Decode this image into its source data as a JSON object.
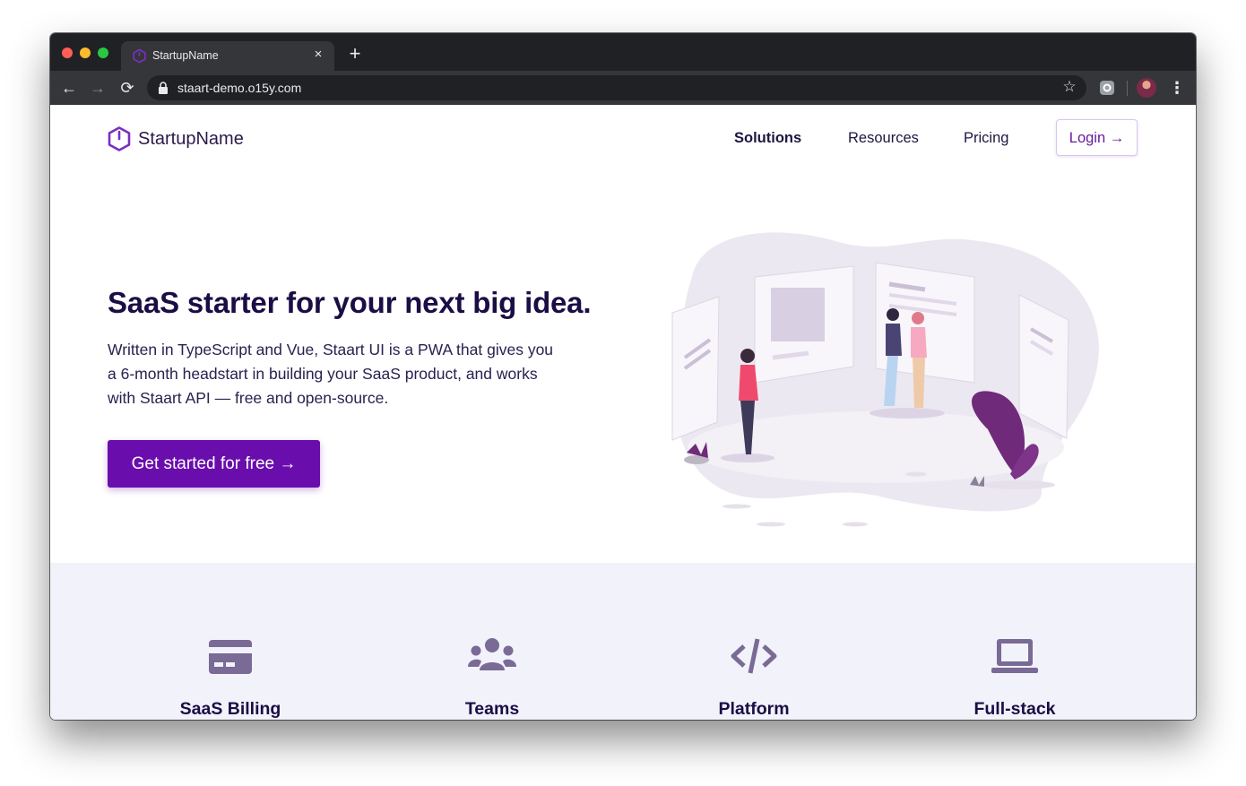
{
  "browser": {
    "tab_title": "StartupName",
    "tab_close": "×",
    "new_tab": "+",
    "url": "staart-demo.o15y.com",
    "back": "←",
    "forward": "→",
    "reload": "⟳",
    "star": "☆",
    "menu": "⋮"
  },
  "header": {
    "brand": "StartupName",
    "nav": {
      "solutions": "Solutions",
      "resources": "Resources",
      "pricing": "Pricing"
    },
    "login_label": "Login →"
  },
  "hero": {
    "title": "SaaS starter for your next big idea.",
    "description": "Written in TypeScript and Vue, Staart UI is a PWA that gives you a 6-month headstart in building your SaaS product, and works with Staart API — free and open-source.",
    "cta_label": "Get started for free →"
  },
  "features": [
    {
      "title": "SaaS Billing",
      "icon": "credit-card-icon"
    },
    {
      "title": "Teams",
      "icon": "users-icon"
    },
    {
      "title": "Platform",
      "icon": "code-icon"
    },
    {
      "title": "Full-stack",
      "icon": "laptop-icon"
    }
  ],
  "colors": {
    "brand": "#6a0dad",
    "heading": "#1b0d45",
    "feature_icon": "#7a6a96",
    "feature_bg": "#f2f2fa"
  }
}
